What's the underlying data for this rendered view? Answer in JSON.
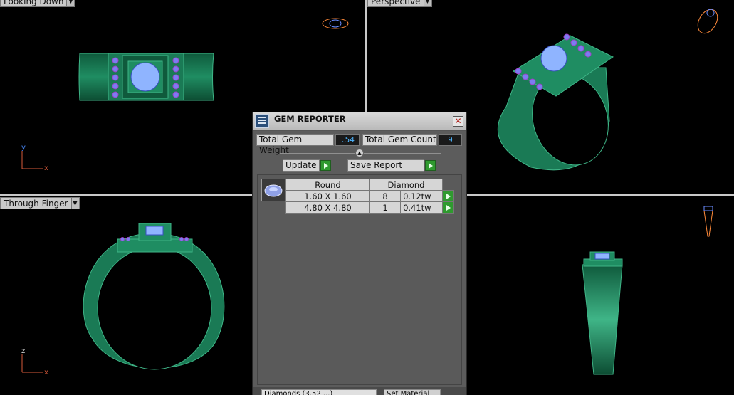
{
  "viewports": {
    "top_left": {
      "label": "Looking Down",
      "axis_v": "y",
      "axis_h": "x"
    },
    "top_right": {
      "label": "Perspective"
    },
    "bottom_left": {
      "label": "Through Finger",
      "axis_v": "z",
      "axis_h": "x"
    },
    "bottom_right": {}
  },
  "gem_reporter": {
    "title": "GEM REPORTER",
    "close_glyph": "✕",
    "total_weight_label": "Total Gem Weight",
    "total_weight_value": ".54",
    "total_count_label": "Total Gem Count",
    "total_count_value": "9",
    "update_label": "Update",
    "save_report_label": "Save Report",
    "table_header": {
      "shape": "Round",
      "material": "Diamond"
    },
    "rows": [
      {
        "size": "1.60 X 1.60",
        "count": "8",
        "weight": "0.12tw"
      },
      {
        "size": "4.80 X 4.80",
        "count": "1",
        "weight": "0.41tw"
      }
    ],
    "bottom_field_text": "Diamonds (3.52 ...)",
    "bottom_button_text": "Set Material"
  },
  "colors": {
    "metal": "#1e8a60",
    "metal_dark": "#0f5a3c",
    "metal_light": "#3fb587",
    "gem": "#8fb4ff",
    "accent_value": "#4fb6ff"
  },
  "icons": {
    "close": "close-icon",
    "go": "play-arrow-icon",
    "logo": "gem-reporter-logo-icon"
  }
}
